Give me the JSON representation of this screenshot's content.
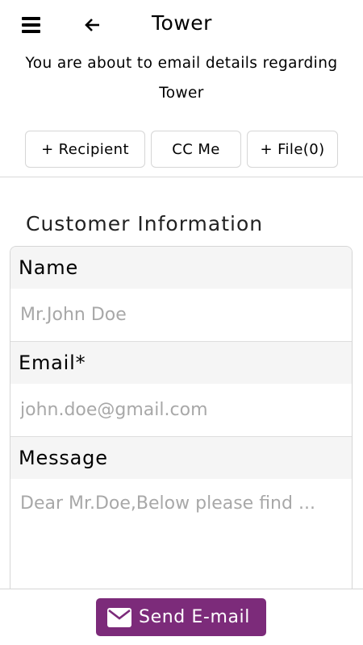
{
  "header": {
    "title": "Tower",
    "menu_icon": "hamburger-menu-icon",
    "back_icon": "arrow-left-icon"
  },
  "intro": {
    "line1": "You are about to email details regarding",
    "line2": "Tower"
  },
  "actions": {
    "recipient_label": "+ Recipient",
    "cc_label": "CC Me",
    "file_label": "+ File(0)"
  },
  "section": {
    "title": "Customer Information"
  },
  "form": {
    "name": {
      "label": "Name",
      "placeholder": "Mr.John Doe",
      "value": ""
    },
    "email": {
      "label": "Email*",
      "placeholder": "john.doe@gmail.com",
      "value": ""
    },
    "message": {
      "label": "Message",
      "placeholder": "Dear Mr.Doe,Below please find ...",
      "value": ""
    }
  },
  "footer": {
    "send_label": "Send E-mail",
    "send_icon": "envelope-icon",
    "accent_color": "#7c2b7a"
  }
}
